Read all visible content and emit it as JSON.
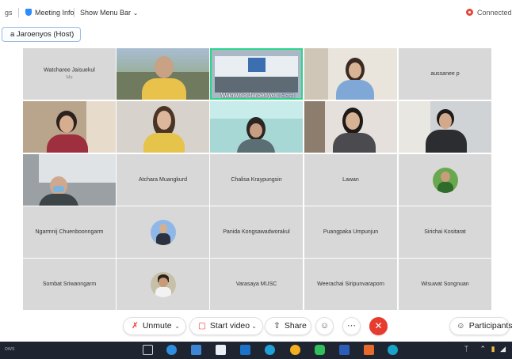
{
  "topbar": {
    "left_clip": "gs",
    "meeting_info": "Meeting Info",
    "show_menu_bar": "Show Menu Bar",
    "connection_status": "Connected"
  },
  "speaker_tag": "a Jaroenyos (Host)",
  "tiles": {
    "watcharee": {
      "name": "Watcharee Jaisuekul",
      "sub": "Me"
    },
    "wanwisa": {
      "name": "Wanwisa Jaroenyos",
      "host": "(Host)"
    },
    "aussanee": {
      "name": "aussanee p"
    },
    "atchara": {
      "name": "Atchara Muangkurd"
    },
    "chalisa": {
      "name": "Chalisa Kraypungsin"
    },
    "lawan": {
      "name": "Lawan"
    },
    "ngarmnij": {
      "name": "Ngarmnij Chuenboonngarm"
    },
    "panida": {
      "name": "Panida Kongsawadworakul"
    },
    "puangpaka": {
      "name": "Puangpaka Umpunjun"
    },
    "sirichai": {
      "name": "Sirichai Kositarat"
    },
    "sombat": {
      "name": "Sombat Sriwanngarm"
    },
    "varasaya": {
      "name": "Varasaya MUSC"
    },
    "weerachai": {
      "name": "Weerachai Siripunvaraporn"
    },
    "wisuwat": {
      "name": "Wisuwat Songnuan"
    }
  },
  "controls": {
    "unmute": "Unmute",
    "start_video": "Start video",
    "share": "Share",
    "participants": "Participants"
  },
  "taskbar": {
    "left_clip": "ows"
  },
  "colors": {
    "accent": "#2d8cff",
    "leave": "#e83b2f",
    "active_speaker": "#2ad68a",
    "tile_bg": "#d8d8d8",
    "taskbar": "#1f2530"
  }
}
